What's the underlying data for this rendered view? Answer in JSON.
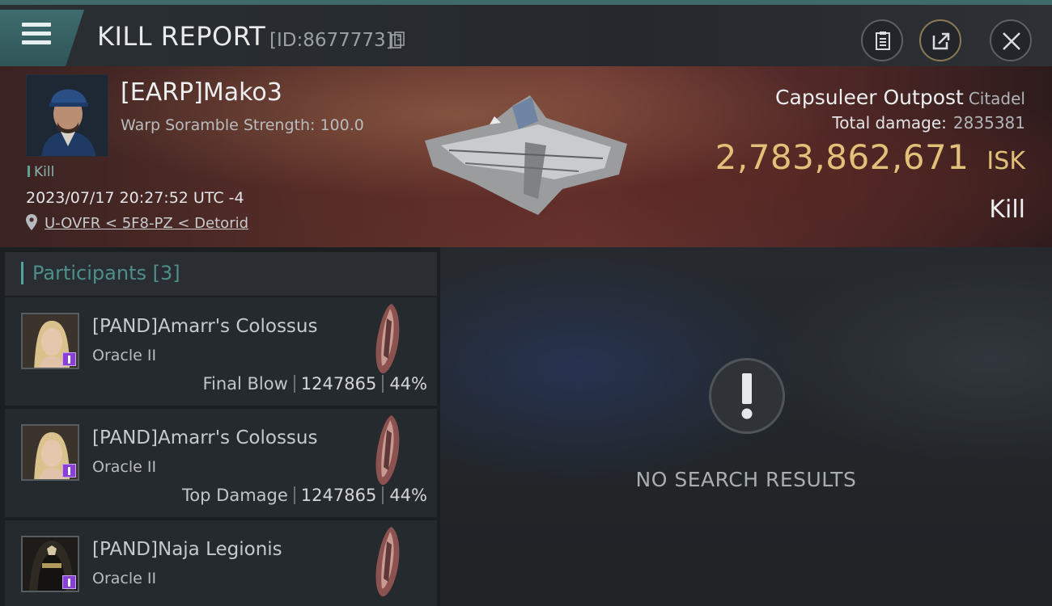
{
  "header": {
    "title": "KILL REPORT",
    "report_id": "[ID:8677773]"
  },
  "victim": {
    "name": "[EARP]Mako3",
    "subtitle": "Warp Soramble Strength: 100.0",
    "tag": "Kill",
    "timestamp": "2023/07/17 20:27:52 UTC -4",
    "location": "U-OVFR < 5F8-PZ < Detorid",
    "structure_name": "Capsuleer Outpost",
    "structure_class": "Citadel",
    "total_damage_label": "Total damage:",
    "total_damage": "2835381",
    "isk_value": "2,783,862,671",
    "isk_unit": "ISK",
    "result": "Kill"
  },
  "participants": {
    "header": "Participants",
    "count": "[3]",
    "items": [
      {
        "name": "[PAND]Amarr's Colossus",
        "ship": "Oracle II",
        "label": "Final Blow",
        "damage": "1247865",
        "percent": "44%"
      },
      {
        "name": "[PAND]Amarr's Colossus",
        "ship": "Oracle II",
        "label": "Top Damage",
        "damage": "1247865",
        "percent": "44%"
      },
      {
        "name": "[PAND]Naja Legionis",
        "ship": "Oracle II"
      }
    ]
  },
  "results": {
    "empty_message": "NO SEARCH RESULTS"
  },
  "colors": {
    "accent": "#4ea59d",
    "isk": "#e2c07a",
    "badge": "#8a3fd6"
  }
}
